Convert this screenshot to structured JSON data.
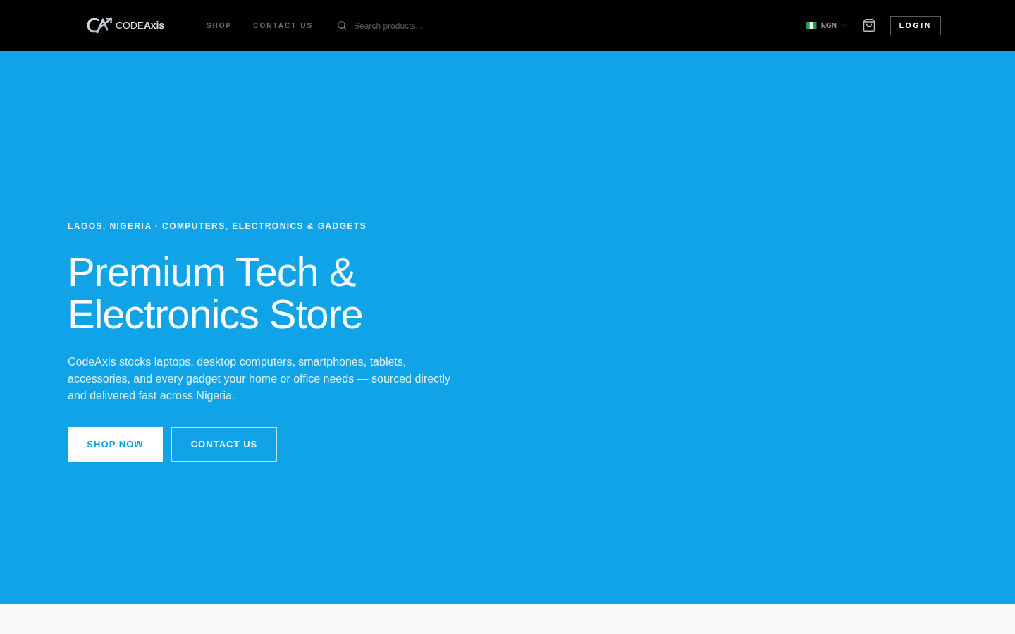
{
  "header": {
    "logo": {
      "text": "CODE**Axis**"
    },
    "nav": [
      {
        "label": "SHOP"
      },
      {
        "label": "CONTACT US"
      }
    ],
    "search": {
      "placeholder": "Search products..."
    },
    "currency": {
      "code": "NGN"
    },
    "login": {
      "label": "LOGIN"
    }
  },
  "hero": {
    "eyebrow": "LAGOS, NIGERIA · COMPUTERS, ELECTRONICS & GADGETS",
    "title": [
      "Premium Tech &",
      "Electronics Store"
    ],
    "description": "CodeAxis stocks laptops, desktop computers, smartphones, tablets, accessories, and every gadget your home or office needs — sourced directly and delivered fast across Nigeria.",
    "buttons": [
      {
        "label": "SHOP NOW",
        "kind": "primary"
      },
      {
        "label": "CONTACT US",
        "kind": "outline"
      }
    ]
  }
}
